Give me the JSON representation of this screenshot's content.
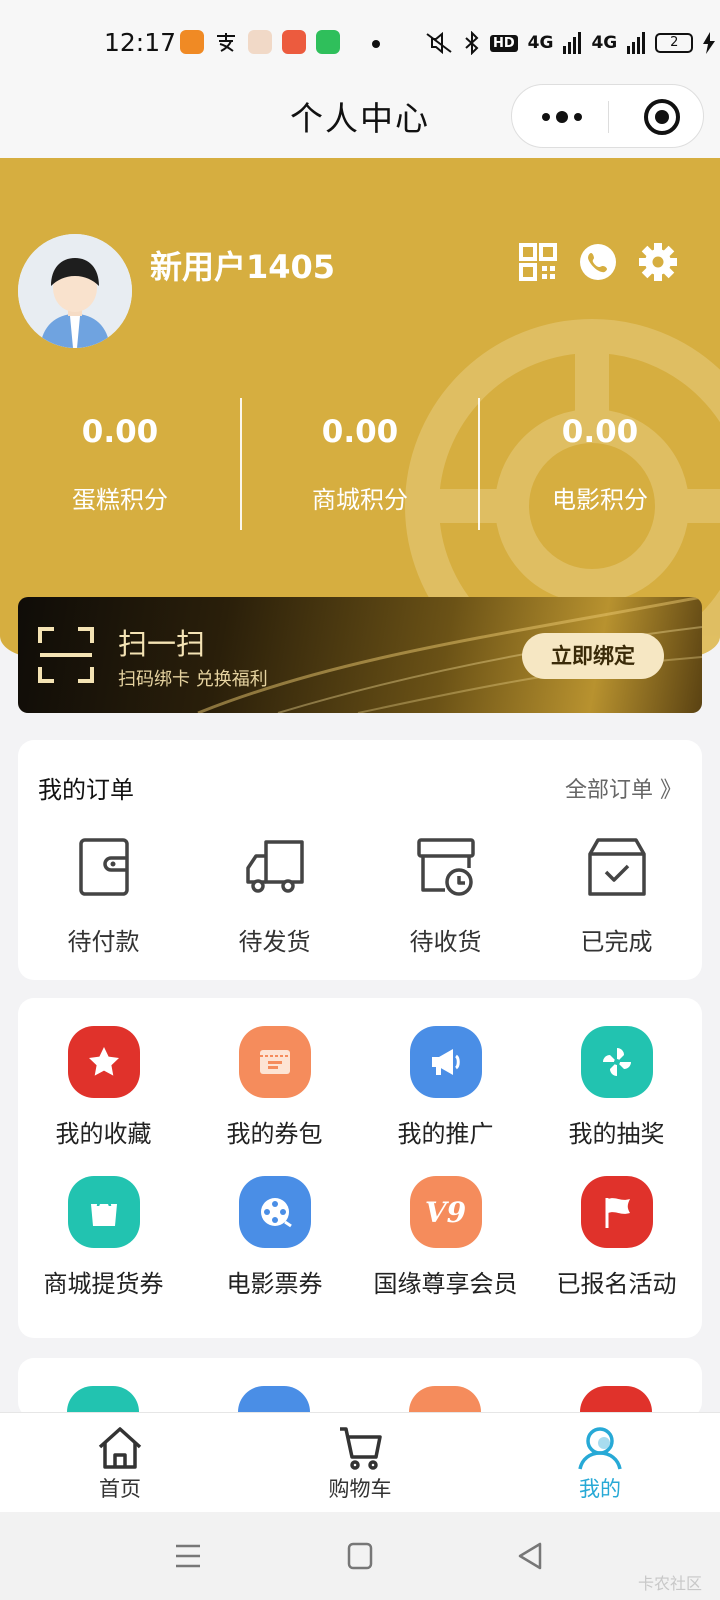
{
  "status_bar": {
    "time": "12:17",
    "hd_label": "HD",
    "network_1": "4G",
    "network_2": "4G",
    "battery": "2",
    "icons": [
      "app-notification-icon",
      "alipay-icon",
      "app-icon",
      "app-icon",
      "message-icon",
      "silent-icon",
      "bluetooth-icon",
      "signal-icon",
      "charging-icon"
    ]
  },
  "title_bar": {
    "title": "个人中心",
    "more_icon": "more-dots-icon",
    "close_icon": "target-icon"
  },
  "profile": {
    "username": "新用户1405",
    "icons": [
      "qrcode-icon",
      "phone-icon",
      "settings-icon"
    ]
  },
  "points": [
    {
      "value": "0.00",
      "label": "蛋糕积分"
    },
    {
      "value": "0.00",
      "label": "商城积分"
    },
    {
      "value": "0.00",
      "label": "电影积分"
    }
  ],
  "scan_banner": {
    "title": "扫一扫",
    "subtitle": "扫码绑卡 兑换福利",
    "button": "立即绑定"
  },
  "orders": {
    "title": "我的订单",
    "all_link": "全部订单 》",
    "items": [
      {
        "label": "待付款",
        "icon": "wallet-icon"
      },
      {
        "label": "待发货",
        "icon": "truck-icon"
      },
      {
        "label": "待收货",
        "icon": "box-clock-icon"
      },
      {
        "label": "已完成",
        "icon": "box-check-icon"
      }
    ]
  },
  "services": [
    {
      "label": "我的收藏",
      "icon": "star-icon",
      "color": "#e0322b"
    },
    {
      "label": "我的券包",
      "icon": "coupon-icon",
      "color": "#f58c5c"
    },
    {
      "label": "我的推广",
      "icon": "megaphone-icon",
      "color": "#4a8ee6"
    },
    {
      "label": "我的抽奖",
      "icon": "pinwheel-icon",
      "color": "#22c3b0"
    },
    {
      "label": "商城提货券",
      "icon": "shopping-bag-icon",
      "color": "#22c3b0"
    },
    {
      "label": "电影票券",
      "icon": "film-reel-icon",
      "color": "#4a8ee6"
    },
    {
      "label": "国缘尊享会员",
      "icon": "v9-icon",
      "icon_text": "V9",
      "color": "#f58c5c"
    },
    {
      "label": "已报名活动",
      "icon": "flag-icon",
      "color": "#e0322b"
    }
  ],
  "tab_bar": [
    {
      "label": "首页",
      "icon": "home-icon",
      "active": false
    },
    {
      "label": "购物车",
      "icon": "cart-icon",
      "active": false
    },
    {
      "label": "我的",
      "icon": "profile-icon",
      "active": true
    }
  ],
  "colors": {
    "header_gold": "#d6ae40",
    "tab_active": "#27a9d6",
    "banner_text": "#f4e3b4"
  },
  "system_nav": {
    "icons": [
      "menu-icon",
      "home-square-icon",
      "back-icon"
    ],
    "corner_text": "卡农社区"
  }
}
